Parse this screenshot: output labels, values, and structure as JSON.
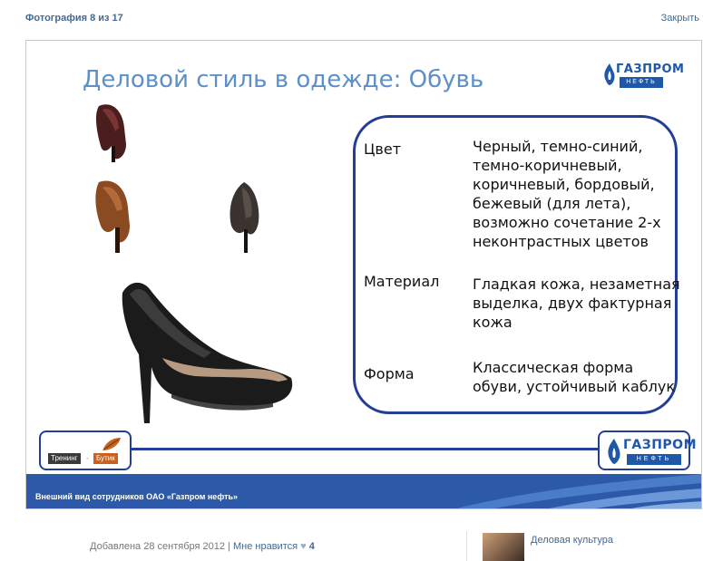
{
  "viewer": {
    "counter": "Фотография 8 из 17",
    "close_label": "Закрыть"
  },
  "slide": {
    "title": "Деловой стиль в одежде: Обувь",
    "logo_text": "ГАЗПРОМ",
    "logo_sub": "НЕФТЬ",
    "rows": [
      {
        "label": "Цвет",
        "lines": [
          "Черный, темно-синий,",
          "темно-коричневый,",
          "коричневый, бордовый,",
          "бежевый (для лета),",
          "возможно сочетание 2-х",
          "неконтрастных цветов"
        ]
      },
      {
        "label": "Материал",
        "lines": [
          "Гладкая кожа, незаметная",
          "выделка, двух фактурная",
          "кожа"
        ]
      },
      {
        "label": "Форма",
        "lines": [
          "Классическая форма",
          "обуви, устойчивый каблук"
        ]
      }
    ],
    "badge_training": "Тренинг",
    "badge_sep": "-",
    "badge_boutique": "Бутик",
    "footer_caption": "Внешний вид сотрудников ОАО «Газпром нефть»"
  },
  "meta": {
    "added": "Добавлена 28 сентября 2012",
    "separator": "|",
    "like_label": "Мне нравится",
    "like_count": "4"
  },
  "album": {
    "title": "Деловая культура"
  },
  "colors": {
    "link": "#45688e",
    "brand_blue": "#233e96",
    "title_blue": "#5f8fc8",
    "band_blue": "#2c5aa8"
  }
}
